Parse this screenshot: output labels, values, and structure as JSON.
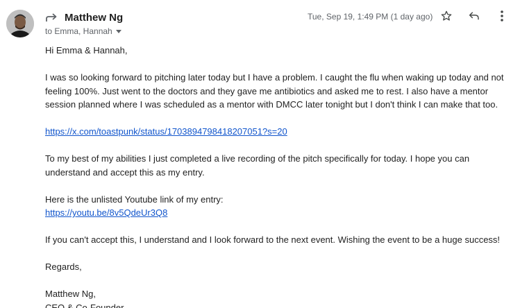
{
  "sender": {
    "name": "Matthew Ng",
    "recipients_label": "to Emma, Hannah",
    "date": "Tue, Sep 19, 1:49 PM (1 day ago)"
  },
  "icons": {
    "forward": "forward-arrow-icon",
    "star": "star-icon",
    "reply": "reply-icon",
    "more": "more-vert-icon",
    "chevron": "chevron-down-icon"
  },
  "colors": {
    "link": "#1155cc",
    "secondary_text": "#5f6368",
    "body_text": "#222222"
  },
  "message": {
    "greeting": "Hi Emma & Hannah,",
    "paragraph1": "I was so looking forward to pitching later today but I have a problem. I caught the flu when waking up today and not feeling 100%. Just went to the doctors and they gave me antibiotics and asked me to rest. I also have a mentor session planned where I was scheduled as a mentor with DMCC later tonight but I don't think I can make that too.",
    "link1": "https://x.com/toastpunk/status/1703894798418207051?s=20",
    "paragraph2": "To my best of my abilities I just completed a live recording of the pitch specifically for today. I hope you can understand and accept this as my entry.",
    "paragraph3_intro": "Here is the unlisted Youtube link of my entry:",
    "link2": "https://youtu.be/8v5QdeUr3Q8",
    "paragraph4": "If you can't accept this, I understand and I look forward to the next event. Wishing the event to be a huge success!",
    "closing": "Regards,",
    "signature_name": "Matthew Ng,",
    "signature_title": "CEO & Co-Founder"
  }
}
